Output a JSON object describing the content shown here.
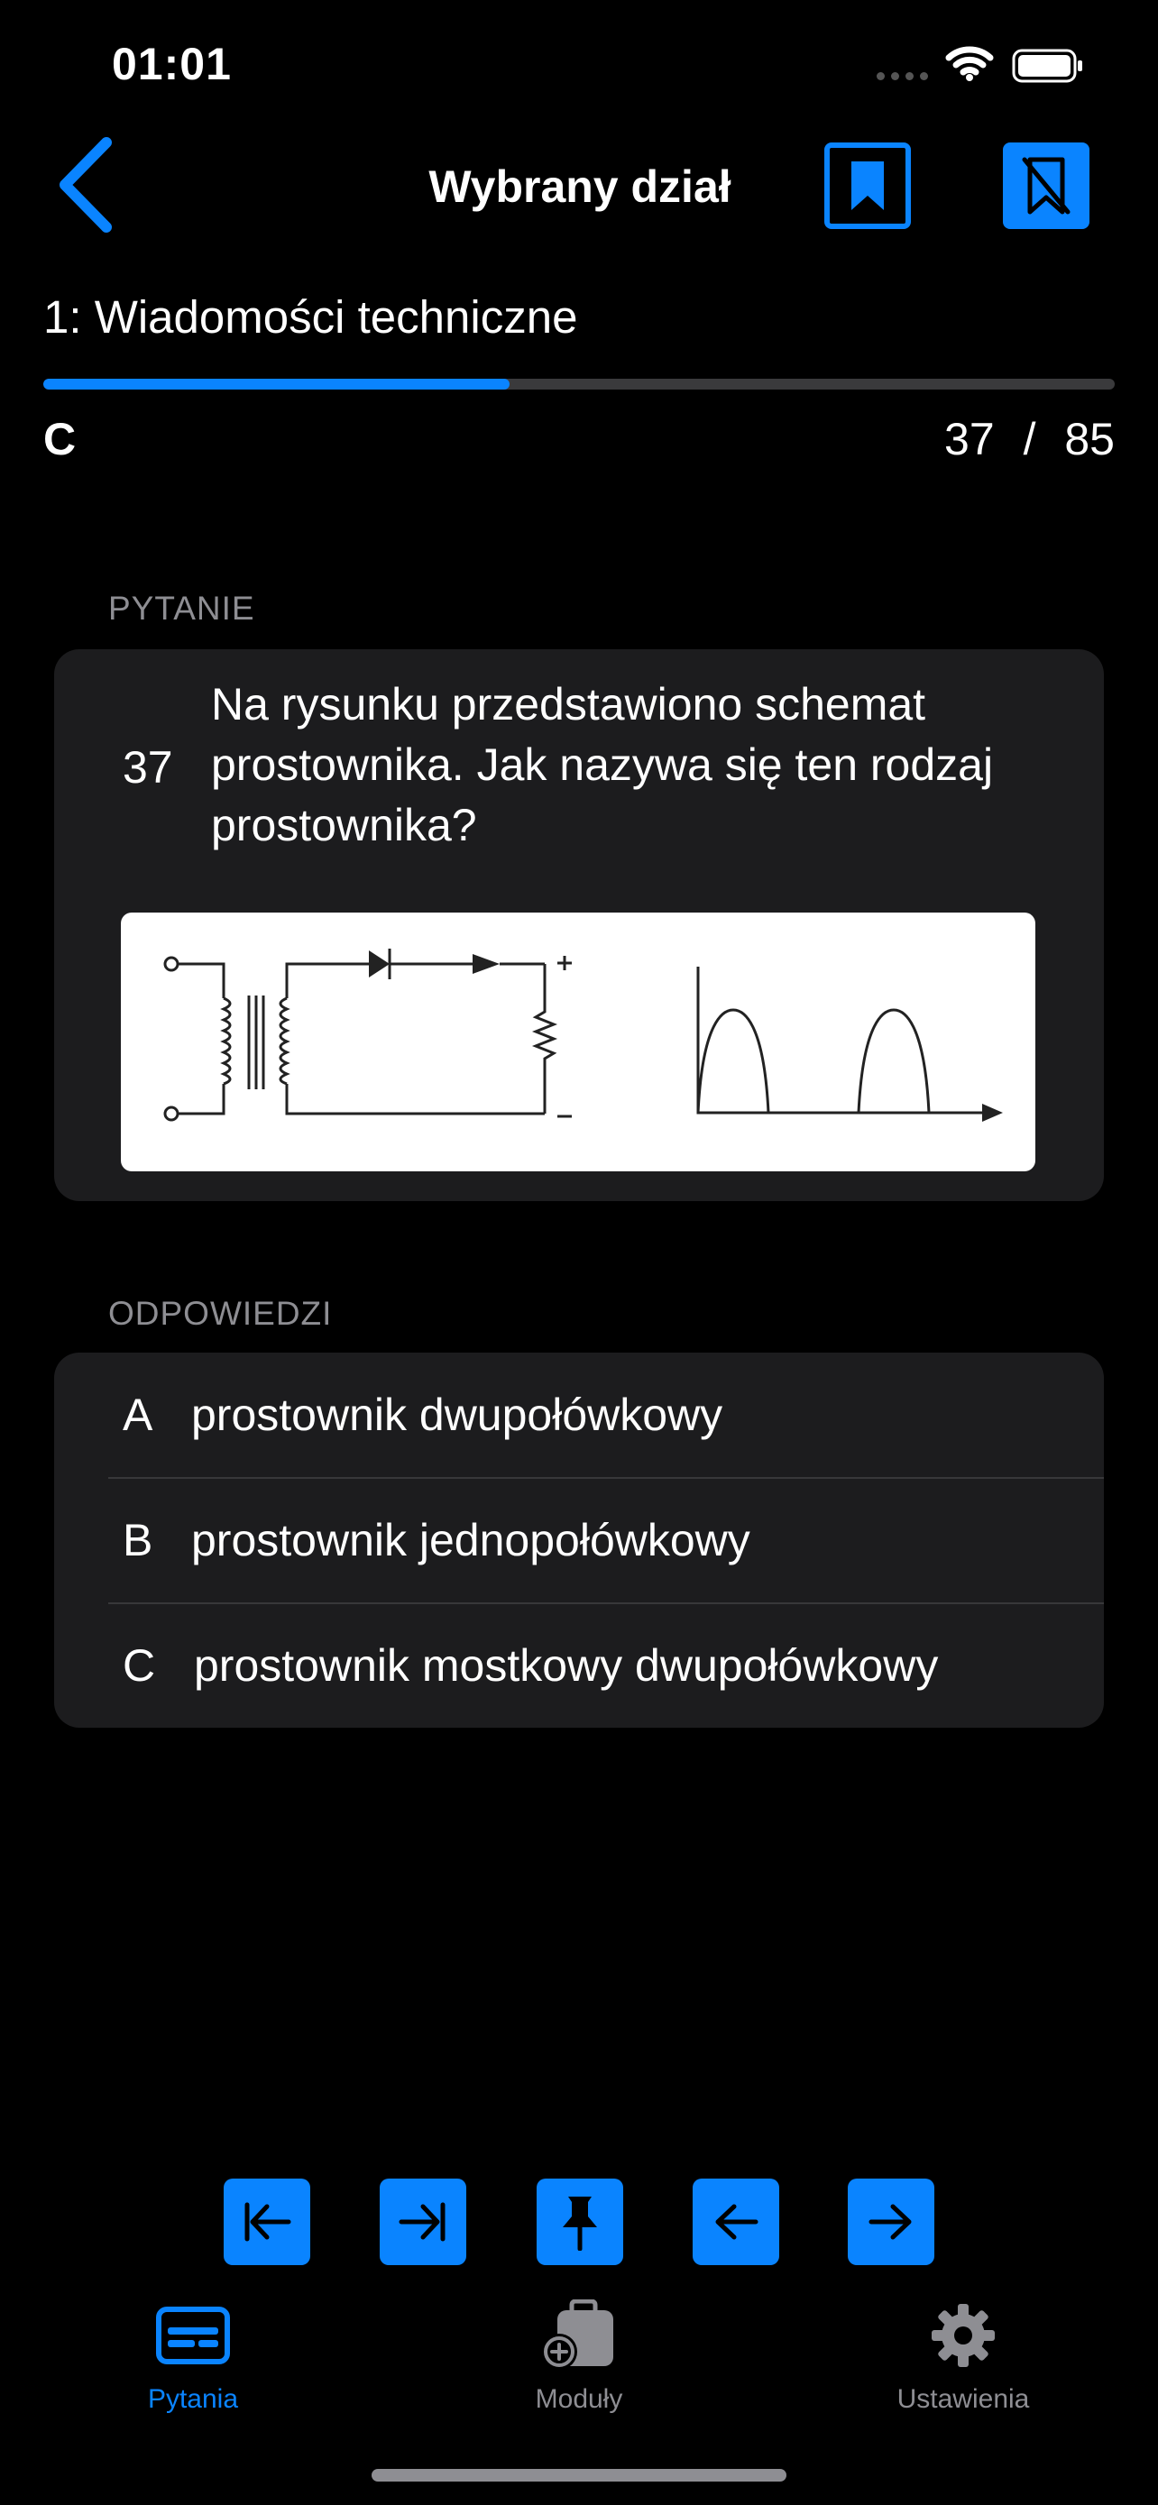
{
  "status_bar": {
    "time": "01:01"
  },
  "nav": {
    "title": "Wybrany dział"
  },
  "section": {
    "title": "1:  Wiadomości techniczne",
    "progress": 0.435
  },
  "result": {
    "correct_letter": "C",
    "current": "37",
    "separator": "/",
    "total": "85"
  },
  "question": {
    "label": "PYTANIE",
    "number": "37",
    "text": "Na rysunku przedstawiono schemat prostownika. Jak nazywa się ten rodzaj prostownika?"
  },
  "answers": {
    "label": "ODPOWIEDZI",
    "items": [
      {
        "letter": "A",
        "text": "prostownik dwupołówkowy"
      },
      {
        "letter": "B",
        "text": "prostownik jednopołówkowy"
      },
      {
        "letter": "C",
        "text": "prostownik mostkowy dwupołówkowy"
      }
    ]
  },
  "toolbar": {
    "items": [
      "first-icon",
      "last-icon",
      "pin-icon",
      "previous-arrow-icon",
      "next-arrow-icon"
    ]
  },
  "tabs": [
    {
      "label": "Pytania",
      "icon": "questions-card-icon",
      "active": true
    },
    {
      "label": "Moduły",
      "icon": "modules-bag-icon",
      "active": false
    },
    {
      "label": "Ustawienia",
      "icon": "gear-icon",
      "active": false
    }
  ],
  "colors": {
    "accent": "#0A84FF",
    "background": "#000000",
    "card": "#1C1C1E",
    "secondary_text": "#8E8E93"
  }
}
